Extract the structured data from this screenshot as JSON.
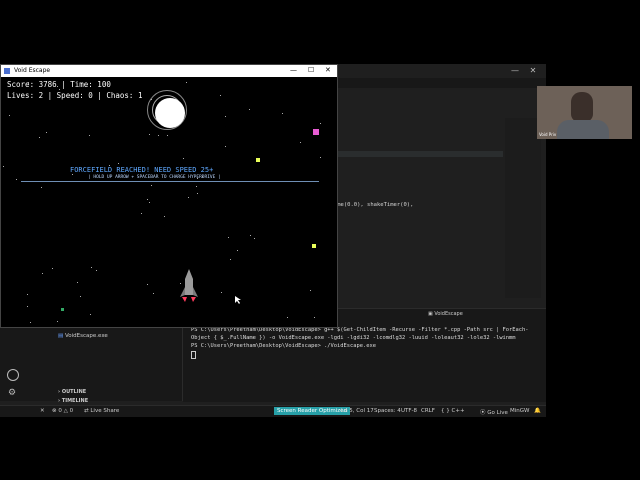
{
  "vscode": {
    "terminal_lines": [
      "PS C:\\Users\\Preetham\\Desktop\\VoidEscape> g++ $(Get-ChildItem -Recurse -Filter *.cpp -Path src | ForEach-Object { $_.FullName }) -o VoidEscape.exe -lgdi -lgdi32 -lcomdlg32 -luuid -loleaut32 -lole32 -lwinmm",
      "PS C:\\Users\\Preetham\\Desktop\\VoidEscape> ./VoidEscape.exe"
    ],
    "terminal_tab": "VoidEscape",
    "editor_code": "ayTime(0.0), shakeTimer(0),",
    "sidebar_file": "VoidEscape.exe",
    "outline_label": "OUTLINE",
    "timeline_label": "TIMELINE",
    "status": {
      "errors": "0",
      "warnings": "0",
      "live_share": "Live Share",
      "screen_reader": "Screen Reader Optimized",
      "position": "Ln 5, Col 17",
      "spaces": "Spaces: 4",
      "encoding": "UTF-8",
      "eol": "CRLF",
      "language": "C++",
      "go_live": "Go Live",
      "platform": "MinGW"
    }
  },
  "game": {
    "window_title": "Void Escape",
    "score_line": "Score: 3786 | Time: 100",
    "lives_line": "Lives: 2 | Speed: 0 | Chaos: 1",
    "message": "FORCEFIELD REACHED! NEED SPEED 25+",
    "hint": "| HOLD UP ARROW + SPACEBAR TO CHARGE HYPERDRIVE |"
  },
  "webcam": {
    "label": "Void Priv"
  },
  "colors": {
    "message_color": "#5fa8ff",
    "hint_color": "#bcd7ff",
    "ship_color": "#9a9a9a",
    "flame_color": "#ff3b5c",
    "pink_square": "#e85cd3",
    "yellow_square": "#eaff5a",
    "status_accent": "#3794ff"
  }
}
